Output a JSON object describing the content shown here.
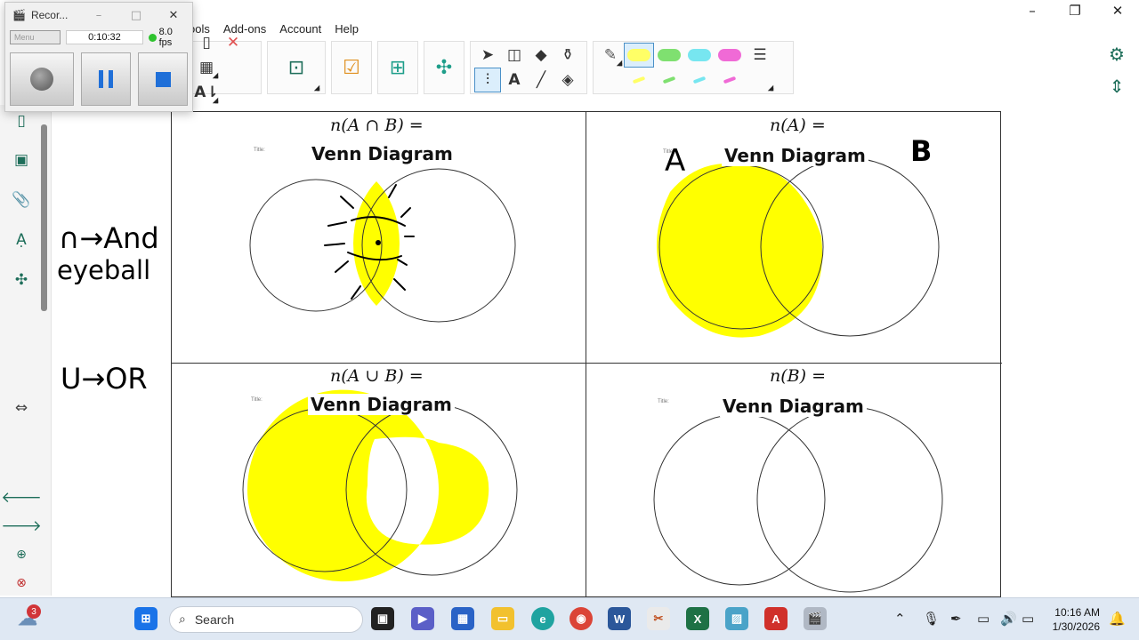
{
  "menubar": {
    "items": [
      "ools",
      "Add-ons",
      "Account",
      "Help"
    ]
  },
  "window_controls": {
    "minimize": "–",
    "restore": "❐",
    "close": "✕"
  },
  "ribbon": {
    "highlighter_colors": [
      "#ffff66",
      "#7fe070",
      "#77e6f0",
      "#f06ad6"
    ],
    "selected_tool": "highlighter-yellow"
  },
  "recorder": {
    "title": "Recor...",
    "menu_label": "Menu",
    "elapsed": "0:10:32",
    "fps": "8.0 fps"
  },
  "notes": {
    "intersection": "∩→And",
    "eyeball": "eyeball",
    "union": "U→OR",
    "set_a": "A",
    "set_b": "B"
  },
  "worksheet": {
    "cells": [
      {
        "label": "n(A ∩ B) =",
        "title": "Venn Diagram",
        "tiny": "Title:",
        "shaded": "intersection"
      },
      {
        "label": "n(A) =",
        "title": "Venn Diagram",
        "tiny": "Title:",
        "shaded": "A"
      },
      {
        "label": "n(A ∪ B) =",
        "title": "Venn Diagram",
        "tiny": "Title:",
        "shaded": "union"
      },
      {
        "label": "n(B) =",
        "title": "Venn Diagram",
        "tiny": "Title:",
        "shaded": "none"
      }
    ]
  },
  "taskbar": {
    "weather_badge": "3",
    "search_label": "Search",
    "time": "10:16 AM",
    "date": "1/30/2026"
  },
  "colors": {
    "highlight_yellow": "#ffff00",
    "accent_green": "#1e6e5a",
    "taskbar_bg": "#dfe8f3"
  }
}
